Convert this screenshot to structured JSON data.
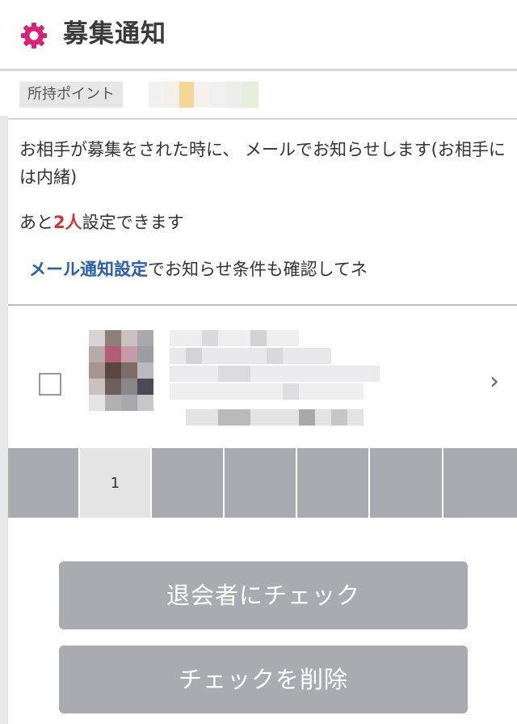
{
  "header": {
    "title": "募集通知",
    "icon": "gear-icon",
    "icon_color": "#d6237a"
  },
  "points": {
    "label": "所持ポイント"
  },
  "info": {
    "description": "お相手が募集をされた時に、 メールでお知らせします(お相手には内緒)",
    "remain_prefix": "あと",
    "remain_count": "2人",
    "remain_suffix": "設定できます",
    "mail_link": "メール通知設定",
    "mail_suffix": "でお知らせ条件も確認してネ"
  },
  "pagination": {
    "pages": [
      "",
      "1",
      "",
      "",
      "",
      "",
      ""
    ],
    "active_index": 1
  },
  "buttons": {
    "withdrawn_label": "退会者にチェック",
    "delete_label": "チェックを削除"
  },
  "colors": {
    "accent": "#d6237a",
    "count_red": "#d0343c",
    "link_blue": "#2a5ea8",
    "button_gray": "#a9abb0"
  }
}
